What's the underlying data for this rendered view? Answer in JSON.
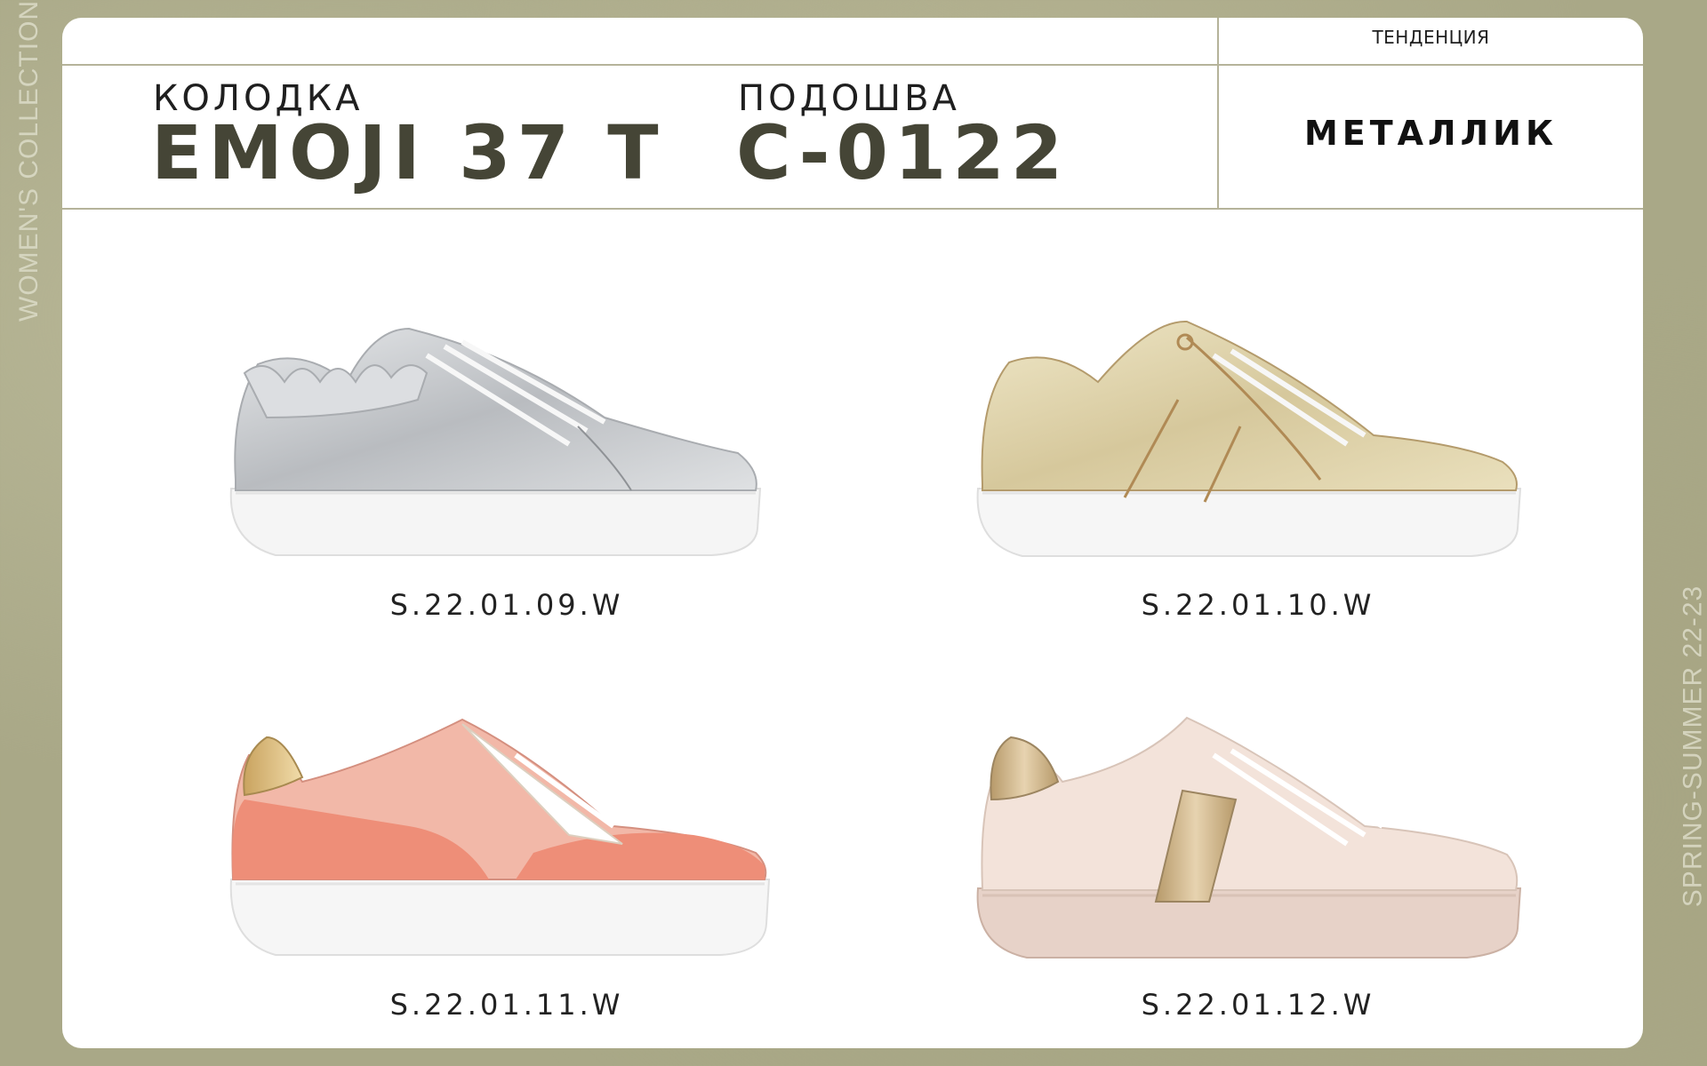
{
  "side": {
    "left_text": "WOMEN'S COLLECTION",
    "right_text": "SPRING-SUMMER 22-23"
  },
  "header": {
    "last_label": "КОЛОДКА",
    "last_value": "EMOJI 37 T",
    "sole_label": "ПОДОШВА",
    "sole_value": "C-0122",
    "trend_label": "ТЕНДЕНЦИЯ",
    "trend_value": "МЕТАЛЛИК"
  },
  "products": [
    {
      "code": "S.22.01.09.W",
      "image": "silver-metallic-sneaker-with-ruffle",
      "color": "#c7c9cc"
    },
    {
      "code": "S.22.01.10.W",
      "image": "gold-metallic-sneaker",
      "color": "#d9cfa9"
    },
    {
      "code": "S.22.01.11.W",
      "image": "coral-pink-sneaker-gold-heel",
      "color": "#ee9a86"
    },
    {
      "code": "S.22.01.12.W",
      "image": "beige-sneaker-gold-stripe",
      "color": "#efdcd2"
    }
  ]
}
